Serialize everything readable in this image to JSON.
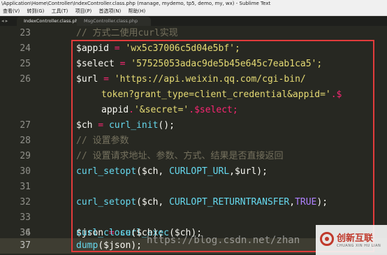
{
  "window": {
    "title": "\\Application\\Home\\Controller\\IndexController.class.php (manage, mydemo, tp5, demo, my, wx) - Sublime Text"
  },
  "menu": [
    "查看(V)",
    "转到(G)",
    "工具(T)",
    "项目(P)",
    "首选项(N)",
    "帮助(H)"
  ],
  "tabs": {
    "nav": "◂ ▸",
    "active": "IndexController.class.php",
    "inactive": "MsgController.class.php"
  },
  "code": {
    "line_numbers": [
      "23",
      "24",
      "25",
      "26",
      "",
      "27",
      "28",
      "29",
      "30",
      "31",
      "32",
      "33",
      "34",
      "35",
      "36",
      "37"
    ],
    "l23": "// 方式二使用curl实现",
    "l24_var": "$appid",
    "l24_op": " = ",
    "l24_val": "'wx5c37006c5d04e5bf';",
    "l25_var": "$select",
    "l25_op": " = ",
    "l25_val": "'57525053adac9de5b45e645c7eab1ca5';",
    "l26_var": "$url",
    "l26_op": " = ",
    "l26_val": "'https://api.weixin.qq.com/cgi-bin/",
    "l26b_val": "token?grant_type=client_credential&appid='",
    "l26b_op": ".$",
    "l26c_a": "appid",
    "l26c_b": ".",
    "l26c_c": "'&secret='",
    "l26c_d": ".$select;",
    "l27_var": "$ch",
    "l27_op": " = ",
    "l27_fn": "curl_init",
    "l27_rest": "();",
    "l28": "// 设置参数",
    "l29": "// 设置请求地址、参数、方式、结果是否直接返回",
    "l30_fn": "curl_setopt",
    "l30_a": "($ch, ",
    "l30_const": "CURLOPT_URL",
    "l30_b": ",$url);",
    "l32_fn": "curl_setopt",
    "l32_a": "($ch, ",
    "l32_const": "CURLOPT_RETURNTRANSFER",
    "l32_b": ",",
    "l32_true": "TRUE",
    "l32_c": ");",
    "l34_var": "$json",
    "l34_op": " = ",
    "l34_fn": "curl_exec",
    "l34_rest": "($ch);",
    "l36_fn": "curl_close",
    "l36_rest": "($ch);",
    "l37_fn": "dump",
    "l37_rest": "($json);"
  },
  "watermark": "https://blog.csdn.net/zhan",
  "logo": {
    "text": "创新互联",
    "subtext": "CHUANG XIN HU LIAN"
  },
  "colors": {
    "background": "#272822",
    "highlight_box": "#e23b3b",
    "keyword": "#f92672",
    "function": "#66d9ef",
    "string": "#e6db74",
    "comment": "#75715e",
    "constant": "#ae81ff"
  }
}
